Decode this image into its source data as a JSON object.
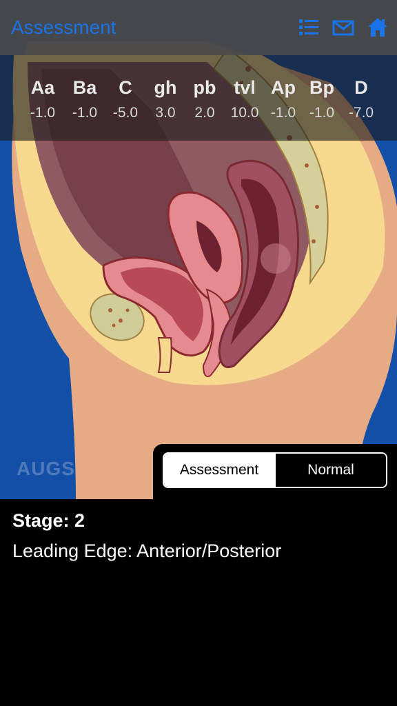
{
  "nav": {
    "title": "Assessment",
    "icons": [
      "list-icon",
      "mail-icon",
      "home-icon"
    ],
    "accent_color": "#1a73e8"
  },
  "metrics": [
    {
      "label": "Aa",
      "value": "-1.0"
    },
    {
      "label": "Ba",
      "value": "-1.0"
    },
    {
      "label": "C",
      "value": "-5.0"
    },
    {
      "label": "gh",
      "value": "3.0"
    },
    {
      "label": "pb",
      "value": "2.0"
    },
    {
      "label": "tvl",
      "value": "10.0"
    },
    {
      "label": "Ap",
      "value": "-1.0"
    },
    {
      "label": "Bp",
      "value": "-1.0"
    },
    {
      "label": "D",
      "value": "-7.0"
    }
  ],
  "watermark": "AUGS",
  "segmented": {
    "options": [
      "Assessment",
      "Normal"
    ],
    "selected": "Assessment"
  },
  "result": {
    "stage": "Stage: 2",
    "leading_edge": "Leading Edge: Anterior/Posterior"
  },
  "colors": {
    "background_blue": "#1550a8",
    "skin": "#e6ab84",
    "fat": "#f6d98e",
    "organ_pink": "#e58a8e",
    "organ_dark": "#7a2a34"
  }
}
